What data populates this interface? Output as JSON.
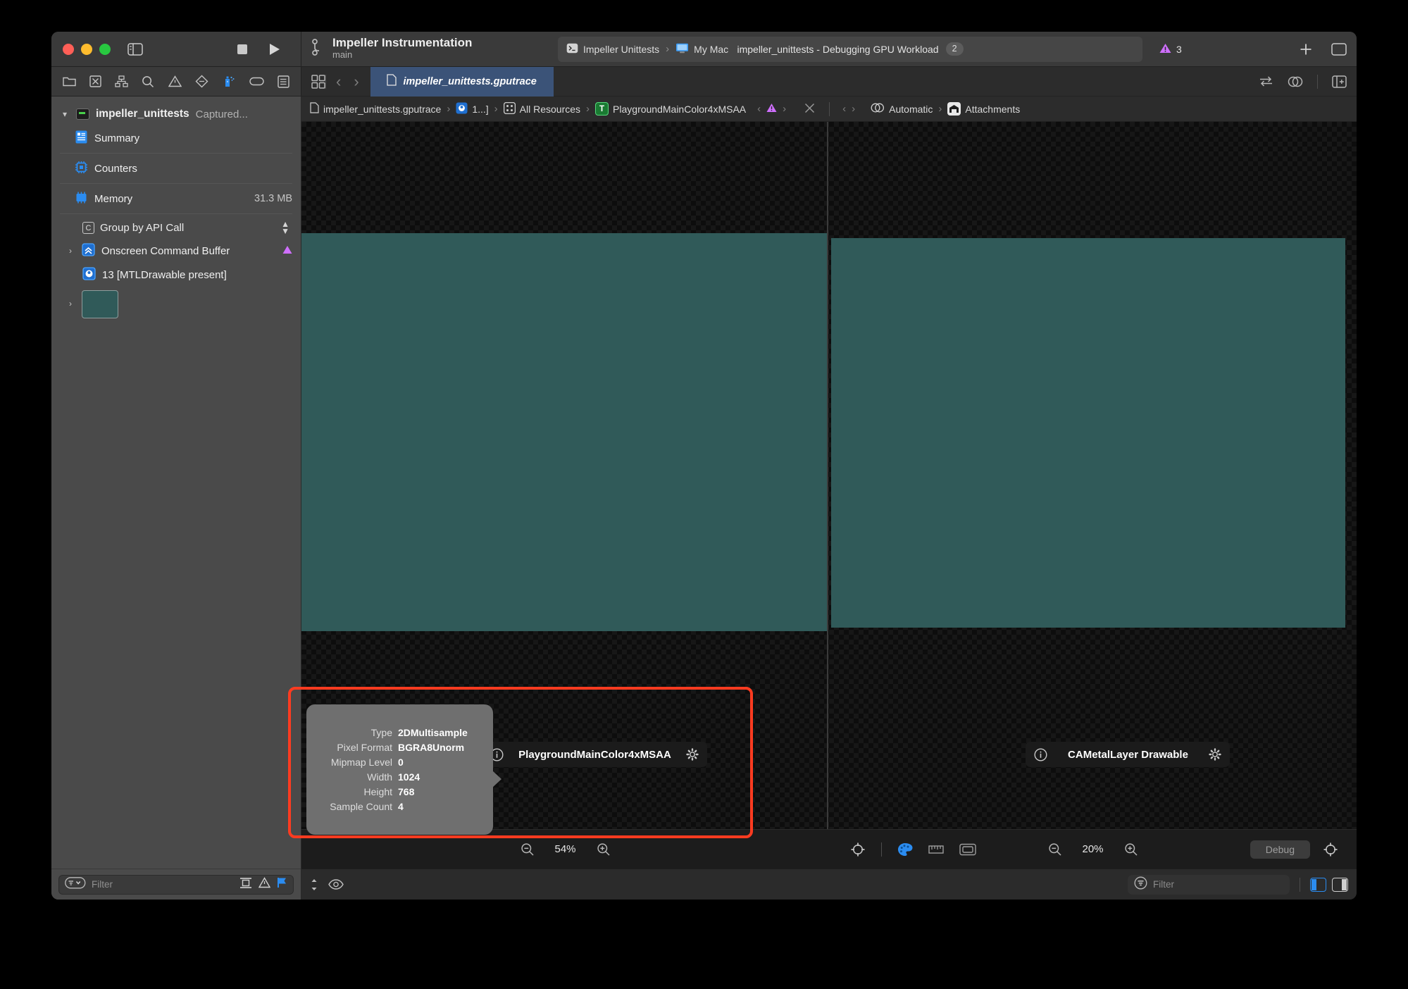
{
  "window": {
    "traffic_lights": [
      "close",
      "minimize",
      "zoom"
    ],
    "scheme": {
      "name": "Impeller Instrumentation",
      "branch": "main"
    },
    "status": {
      "destination_scheme": "Impeller Unittests",
      "destination_device": "My Mac",
      "activity": "impeller_unittests - Debugging GPU Workload",
      "activity_badge": "2"
    },
    "warnings_count": "3"
  },
  "toolbar": {
    "icons": [
      "folder-icon",
      "x-box-icon",
      "hierarchy-icon",
      "search-icon",
      "warning-triangle-icon",
      "diamond-icon",
      "spray-bottle-icon",
      "tag-icon",
      "list-icon"
    ],
    "file_tab": "impeller_unittests.gputrace",
    "nav_back": "‹",
    "nav_forward": "›",
    "end_icons": [
      "swap-icon",
      "venn-icon",
      "inspector-toggle-icon"
    ]
  },
  "sidebar": {
    "root": {
      "title": "impeller_unittests",
      "subtitle": "Captured..."
    },
    "items": [
      {
        "label": "Summary",
        "icon": "summary-icon",
        "value": ""
      },
      {
        "label": "Counters",
        "icon": "counters-chip-icon",
        "value": ""
      },
      {
        "label": "Memory",
        "icon": "memory-chip-icon",
        "value": "31.3 MB"
      }
    ],
    "group_by": {
      "key": "C",
      "label": "Group by API Call"
    },
    "tree": [
      {
        "label": "Onscreen Command Buffer",
        "icon": "command-buffer-icon",
        "warning": true
      },
      {
        "label": "13 [MTLDrawable present]",
        "icon": "drawable-icon",
        "warning": false
      }
    ],
    "thumbnail_color": "#305a59",
    "filter": {
      "placeholder": "Filter",
      "icons": [
        "filter-dropdown-icon",
        "compare-icon",
        "warning-triangle-icon",
        "flag-icon"
      ]
    }
  },
  "breadcrumb": {
    "items": [
      {
        "label": "impeller_unittests.gputrace",
        "icon": "file-icon"
      },
      {
        "label": "1...]",
        "icon": "drawable-icon"
      },
      {
        "label": "All Resources",
        "icon": "grid-icon"
      },
      {
        "label": "PlaygroundMainColor4xMSAA",
        "icon": "texture-icon",
        "icon_letter": "T",
        "icon_color": "#1a7a32"
      }
    ],
    "warning_icon": "warning-triangle-icon",
    "close_icon": "close-icon",
    "right_items": [
      {
        "label": "Automatic",
        "icon": "venn-icon"
      },
      {
        "label": "Attachments",
        "icon": "attachments-icon"
      }
    ]
  },
  "canvas": {
    "left_pane": {
      "attachment_label": "PlaygroundMainColor4xMSAA",
      "zoom": "54%",
      "info_icon": "info-icon",
      "settings_icon": "gear-icon"
    },
    "right_pane": {
      "attachment_label": "CAMetalLayer Drawable",
      "zoom": "20%",
      "info_icon": "info-icon",
      "settings_icon": "gear-icon",
      "debug_label": "Debug"
    },
    "texture_color": "#305a59",
    "tool_icons": [
      "crosshair-icon",
      "palette-icon",
      "ruler-icon",
      "frame-icon"
    ]
  },
  "popover": {
    "rows": [
      {
        "key": "Type",
        "value": "2DMultisample"
      },
      {
        "key": "Pixel Format",
        "value": "BGRA8Unorm"
      },
      {
        "key": "Mipmap Level",
        "value": "0"
      },
      {
        "key": "Width",
        "value": "1024"
      },
      {
        "key": "Height",
        "value": "768"
      },
      {
        "key": "Sample Count",
        "value": "4"
      }
    ],
    "highlight_color": "#ff3b20"
  },
  "footer": {
    "filter_placeholder": "Filter",
    "eye_icon": "eye-icon",
    "resize_icon": "resize-handle-icon"
  },
  "colors": {
    "accent_blue": "#2b8cf0",
    "tab_blue": "#3b5378",
    "warning_purple": "#cf6fff",
    "teal": "#305a59",
    "red_highlight": "#ff3b20"
  }
}
